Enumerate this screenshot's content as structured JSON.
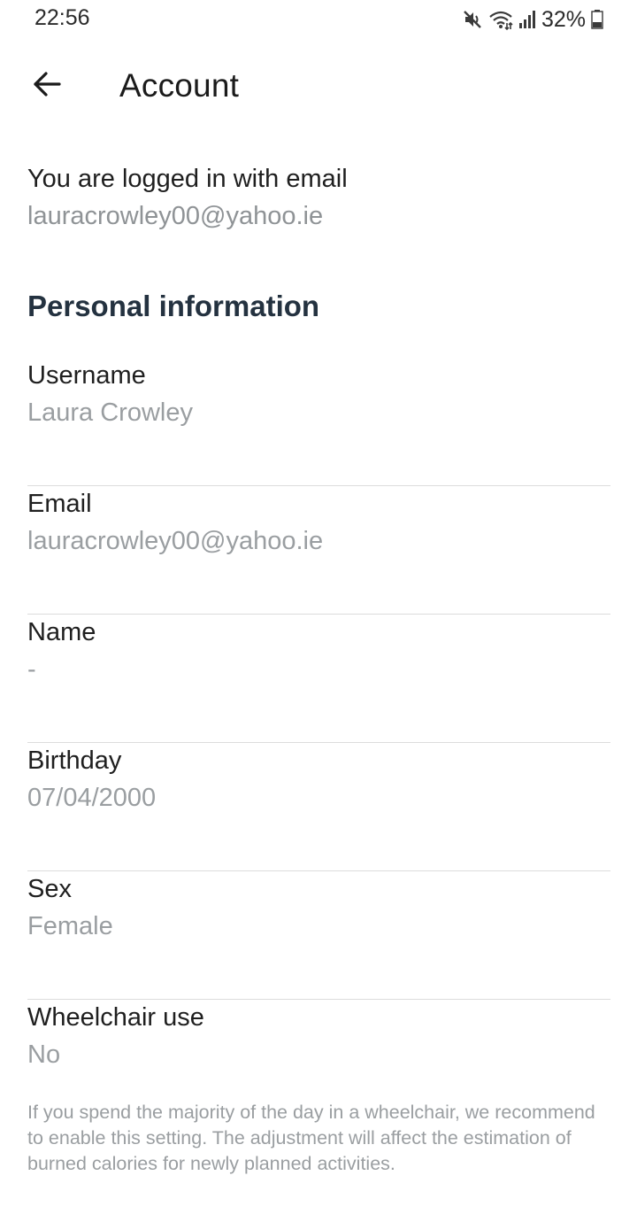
{
  "status_bar": {
    "time": "22:56",
    "battery_percent": "32%",
    "icons": [
      "mute-icon",
      "wifi-icon",
      "signal-icon",
      "battery-icon"
    ]
  },
  "app_bar": {
    "title": "Account",
    "back_icon": "arrow-left-icon"
  },
  "login": {
    "text": "You are logged in with email",
    "email": "lauracrowley00@yahoo.ie"
  },
  "personal_info": {
    "title": "Personal information",
    "fields": [
      {
        "label": "Username",
        "value": "Laura Crowley"
      },
      {
        "label": "Email",
        "value": "lauracrowley00@yahoo.ie"
      },
      {
        "label": "Name",
        "value": "-"
      },
      {
        "label": "Birthday",
        "value": "07/04/2000"
      },
      {
        "label": "Sex",
        "value": "Female"
      },
      {
        "label": "Wheelchair use",
        "value": "No"
      }
    ]
  },
  "wheelchair_note": "If you spend the majority of the day in a wheelchair, we recommend to enable this setting. The adjustment will affect the estimation of burned calories for newly planned activities.",
  "colors": {
    "title_text": "#1b1b1b",
    "section_title": "#243240",
    "value_text": "#9a9ea1",
    "divider": "#dcdcdc"
  }
}
